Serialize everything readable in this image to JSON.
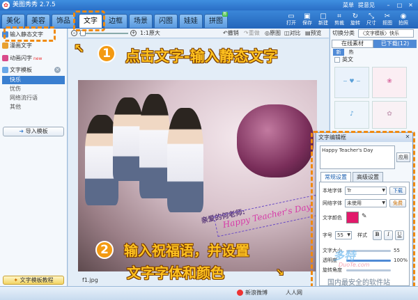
{
  "app": {
    "name": "美图秀秀 2.7.5",
    "menu": "菜单",
    "feedback": "提意见"
  },
  "colors": {
    "accent": "#2a6ec6",
    "callout": "#ffc21f",
    "step": "#f39a13",
    "highlight": "#f08a10",
    "text_color_swatch": "#e2196b"
  },
  "tabs": [
    {
      "label": "美化"
    },
    {
      "label": "美容"
    },
    {
      "label": "饰品"
    },
    {
      "label": "文字"
    },
    {
      "label": "边框"
    },
    {
      "label": "场景"
    },
    {
      "label": "闪图"
    },
    {
      "label": "娃娃"
    },
    {
      "label": "拼图",
      "badge": "新"
    }
  ],
  "toolbar": [
    {
      "label": "打开",
      "icon": "folder-icon"
    },
    {
      "label": "保存",
      "icon": "save-icon"
    },
    {
      "label": "新建",
      "icon": "new-icon"
    },
    {
      "label": "剪裁",
      "icon": "crop-icon"
    },
    {
      "label": "旋转",
      "icon": "rotate-icon"
    },
    {
      "label": "尺寸",
      "icon": "resize-icon"
    },
    {
      "label": "抠图",
      "icon": "cutout-icon"
    },
    {
      "label": "拍照",
      "icon": "camera-icon"
    }
  ],
  "left": {
    "items": [
      {
        "label": "输入静态文字"
      },
      {
        "label": "漫画文字"
      },
      {
        "label": "动画闪字",
        "badge": "new"
      },
      {
        "label": "文字模板"
      }
    ],
    "subitems": [
      "快乐",
      "忧伤",
      "网络流行语",
      "其他"
    ],
    "import": "导入模板",
    "tutorial": "文字模板教程"
  },
  "center": {
    "zoom_label": "1:1原大",
    "undo": "撤销",
    "redo": "重做",
    "original": "原图",
    "compare": "对比",
    "preview": "预览",
    "filename": "f1.jpg"
  },
  "photo": {
    "greeting_cn": "亲爱的何老师:",
    "greeting_en": "Happy Teacher's Day"
  },
  "right": {
    "category_label": "切换分类",
    "category_value": "〈文字模板〉快乐",
    "tab_online": "在线素材",
    "tab_downloaded": "已下载(12)",
    "tag_new": "新",
    "tag_hot": "热",
    "group": "英文"
  },
  "dialog": {
    "title": "文字编辑框",
    "text": "Happy Teacher's Day",
    "apply": "应用",
    "tab_general": "常规设置",
    "tab_advanced": "高级设置",
    "local_font_label": "本地字体",
    "local_font_value": "Tr",
    "download": "下载",
    "web_font_label": "网络字体",
    "web_font_value": "未使用",
    "free": "免费",
    "color_label": "文字颜色",
    "size_label": "字号",
    "size_value": "55",
    "style_label": "样式",
    "bold": "B",
    "italic": "I",
    "underline": "U",
    "text_size_label": "文字大小",
    "text_size_value": "55",
    "opacity_label": "透明度",
    "opacity_value": "100%",
    "opacity_fraction": 1.0,
    "rotation_label": "旋转角度"
  },
  "callouts": {
    "step1_num": "1",
    "step1": "点击文字-输入静态文字",
    "step2_num": "2",
    "step2_line1": "输入祝福语，并设置",
    "step2_line2": "文字字体和颜色"
  },
  "status": {
    "weibo": "新浪微博",
    "renren": "人人网",
    "safety": "国内最安全的软件站",
    "watermark": "多特",
    "watermark_url": "DuoTe.com"
  }
}
